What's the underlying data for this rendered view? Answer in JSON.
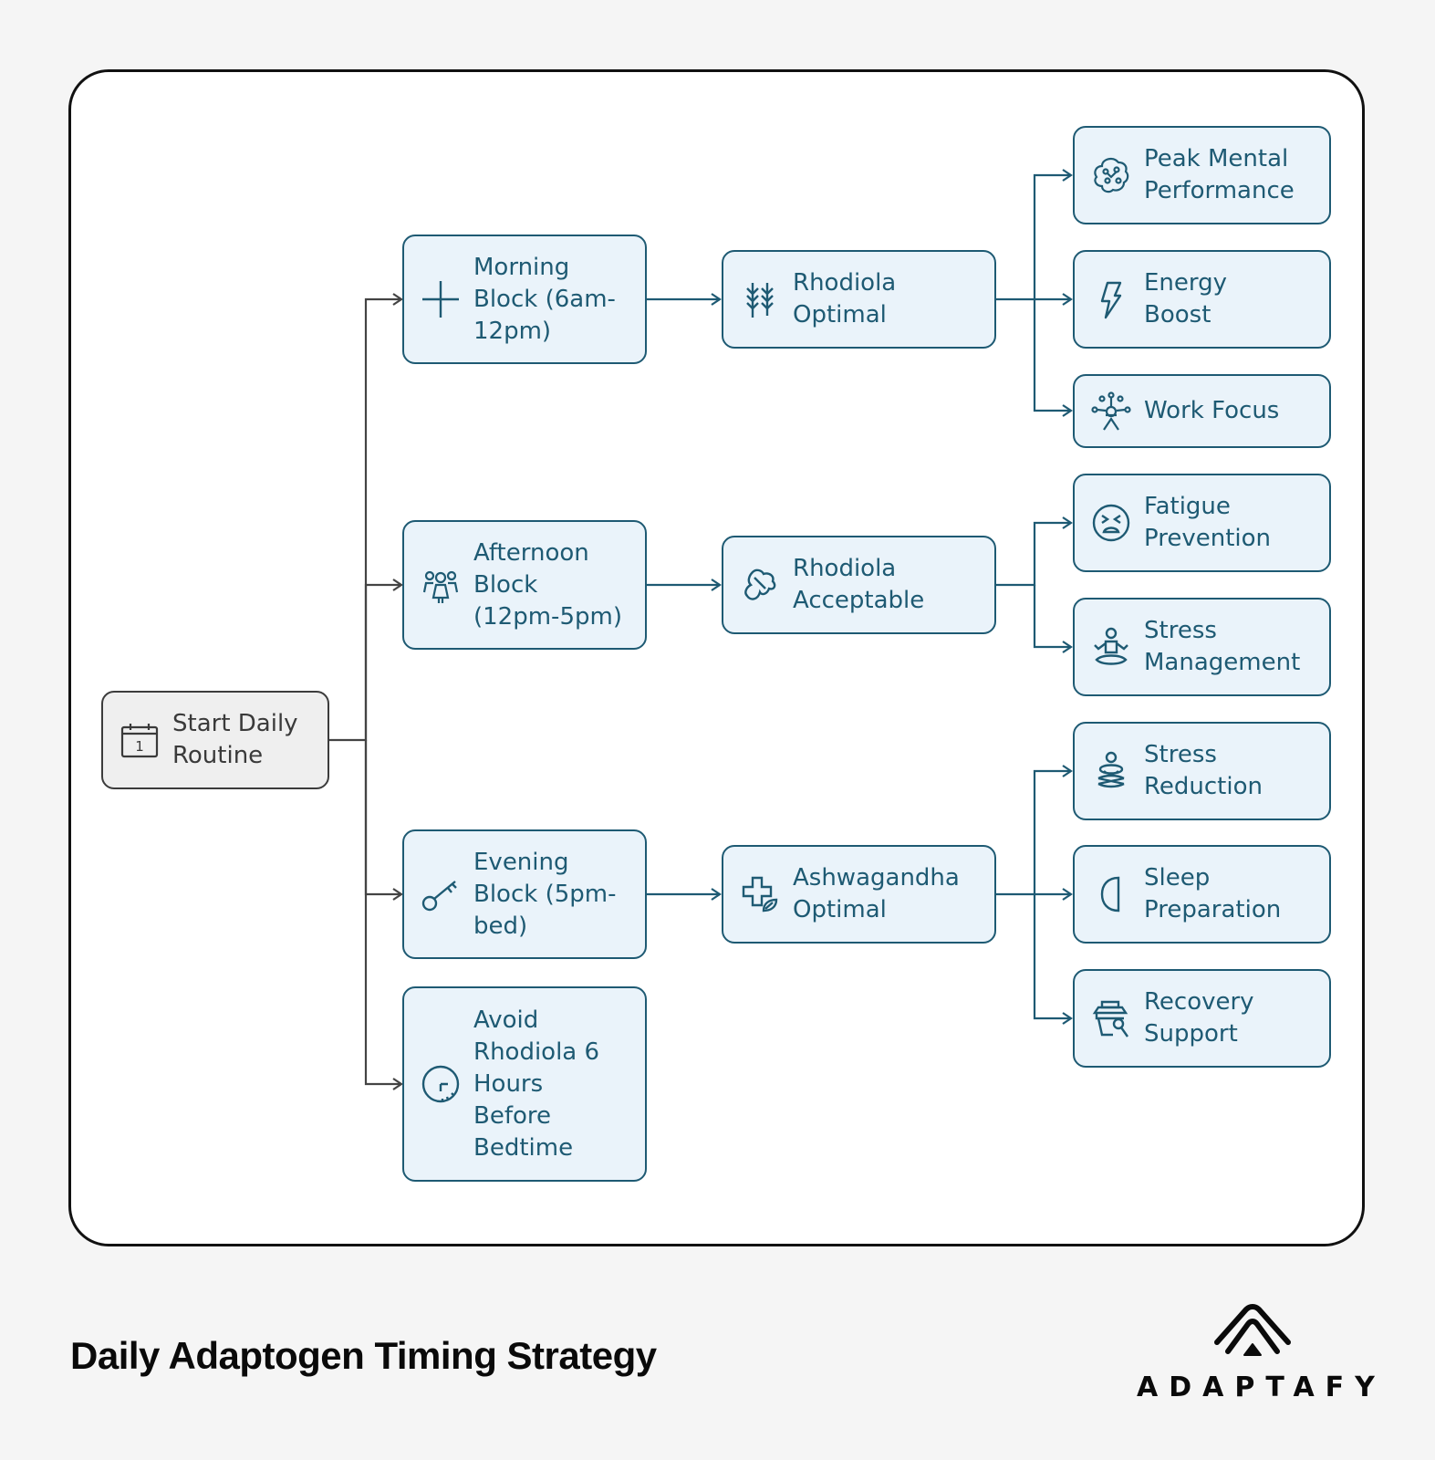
{
  "title": "Daily Adaptogen Timing Strategy",
  "brand": {
    "name": "ADAPTAFY",
    "logo_icon": "layered-arches-logo"
  },
  "colors": {
    "node_border": "#1e5a73",
    "node_fill": "#eaf3fa",
    "start_border": "#3c3c3c",
    "start_fill": "#efefef",
    "start_connector": "#444444",
    "branch_connector": "#1e5a73"
  },
  "nodes": {
    "start": {
      "label": "Start Daily\nRoutine",
      "icon": "calendar-day-1-icon"
    },
    "morning": {
      "label": "Morning\nBlock (6am-\n12pm)",
      "icon": "plus-cross-icon"
    },
    "afternoon": {
      "label": "Afternoon\nBlock\n(12pm-5pm)",
      "icon": "group-people-icon"
    },
    "evening": {
      "label": "Evening\nBlock (5pm-\nbed)",
      "icon": "key-icon"
    },
    "avoid": {
      "label": "Avoid\nRhodiola 6\nHours\nBefore\nBedtime",
      "icon": "clock-icon"
    },
    "rhodiola_optimal": {
      "label": "Rhodiola\nOptimal",
      "icon": "herb-sprigs-icon"
    },
    "rhodiola_acceptable": {
      "label": "Rhodiola\nAcceptable",
      "icon": "ginseng-root-icon"
    },
    "ashwagandha_optimal": {
      "label": "Ashwagandha\nOptimal",
      "icon": "medical-cross-leaf-icon"
    },
    "peak_mental": {
      "label": "Peak Mental\nPerformance",
      "icon": "brain-icon"
    },
    "energy_boost": {
      "label": "Energy\nBoost",
      "icon": "lightning-bolt-icon"
    },
    "work_focus": {
      "label": "Work Focus",
      "icon": "focused-person-icon"
    },
    "fatigue_prevention": {
      "label": "Fatigue\nPrevention",
      "icon": "tired-face-icon"
    },
    "stress_management": {
      "label": "Stress\nManagement",
      "icon": "meditation-icon"
    },
    "stress_reduction": {
      "label": "Stress\nReduction",
      "icon": "meditating-person-icon"
    },
    "sleep_preparation": {
      "label": "Sleep\nPreparation",
      "icon": "half-moon-icon"
    },
    "recovery_support": {
      "label": "Recovery\nSupport",
      "icon": "supplement-jar-icon"
    }
  },
  "edges": [
    [
      "start",
      "morning"
    ],
    [
      "start",
      "afternoon"
    ],
    [
      "start",
      "evening"
    ],
    [
      "start",
      "avoid"
    ],
    [
      "morning",
      "rhodiola_optimal"
    ],
    [
      "afternoon",
      "rhodiola_acceptable"
    ],
    [
      "evening",
      "ashwagandha_optimal"
    ],
    [
      "rhodiola_optimal",
      "peak_mental"
    ],
    [
      "rhodiola_optimal",
      "energy_boost"
    ],
    [
      "rhodiola_optimal",
      "work_focus"
    ],
    [
      "rhodiola_acceptable",
      "fatigue_prevention"
    ],
    [
      "rhodiola_acceptable",
      "stress_management"
    ],
    [
      "ashwagandha_optimal",
      "stress_reduction"
    ],
    [
      "ashwagandha_optimal",
      "sleep_preparation"
    ],
    [
      "ashwagandha_optimal",
      "recovery_support"
    ]
  ]
}
